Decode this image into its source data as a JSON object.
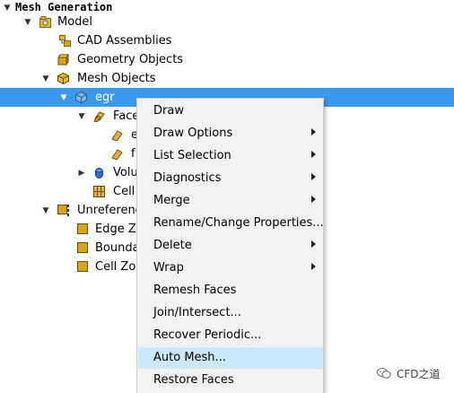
{
  "tree": {
    "root": "Mesh Generation",
    "model": "Model",
    "cad_assemblies": "CAD Assemblies",
    "geometry_objects": "Geometry Objects",
    "mesh_objects": "Mesh Objects",
    "egr": "egr",
    "faces": "Face",
    "face_item_1": "e",
    "face_item_2": "f",
    "volumes": "Volu",
    "cell_zones_1": "Cell",
    "unreferenced": "Unreferenc",
    "edge_zones": "Edge Zo",
    "boundary": "Bounda",
    "cell_zones_2": "Cell Zon"
  },
  "context_menu": {
    "items": [
      {
        "label": "Draw",
        "submenu": false
      },
      {
        "label": "Draw Options",
        "submenu": true
      },
      {
        "label": "List Selection",
        "submenu": true
      },
      {
        "label": "Diagnostics",
        "submenu": true
      },
      {
        "label": "Merge",
        "submenu": true
      },
      {
        "label": "Rename/Change Properties...",
        "submenu": false
      },
      {
        "label": "Delete",
        "submenu": true
      },
      {
        "label": "Wrap",
        "submenu": true
      },
      {
        "label": "Remesh Faces",
        "submenu": false
      },
      {
        "label": "Join/Intersect...",
        "submenu": false
      },
      {
        "label": "Recover Periodic...",
        "submenu": false
      },
      {
        "label": "Auto Mesh...",
        "submenu": false,
        "highlighted": true
      },
      {
        "label": "Restore Faces",
        "submenu": false
      }
    ]
  },
  "watermark": "CFD之道",
  "colors": {
    "selection": "#3a98ee",
    "menu_bg": "#f2f2f2",
    "menu_highlight": "#cce8fb",
    "icon_orange": "#d9a21b"
  }
}
